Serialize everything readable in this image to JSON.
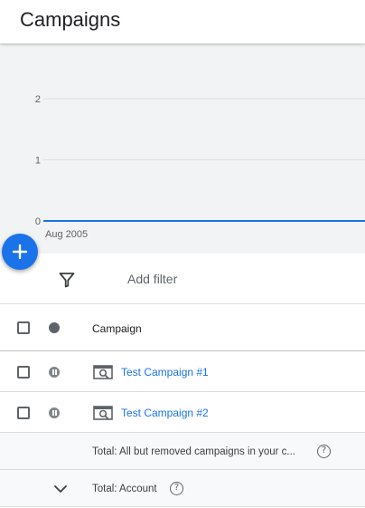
{
  "page": {
    "title": "Campaigns"
  },
  "chart_data": {
    "type": "line",
    "x": [
      "Aug 2005"
    ],
    "series": [
      {
        "values": [
          0
        ]
      }
    ],
    "y_ticks": [
      "0",
      "1",
      "2"
    ],
    "x_ticks": [
      "Aug 2005"
    ],
    "ylim": [
      0,
      2
    ],
    "grid": true,
    "colors": {
      "line": "#1a73e8",
      "grid": "#dadce0"
    }
  },
  "fab": {
    "icon": "plus-icon"
  },
  "filter": {
    "icon": "filter-icon",
    "label": "Add filter"
  },
  "table": {
    "columns": {
      "campaign": "Campaign"
    },
    "rows": [
      {
        "name": "Test Campaign #1",
        "status_icon": "pause-icon",
        "type_icon": "search-campaign-icon"
      },
      {
        "name": "Test Campaign #2",
        "status_icon": "pause-icon",
        "type_icon": "search-campaign-icon"
      }
    ],
    "totals": [
      {
        "label": "Total: All but removed campaigns in your c...",
        "help": "?"
      },
      {
        "label": "Total: Account",
        "help": "?",
        "expand_icon": "chevron-down-icon"
      }
    ]
  },
  "colors": {
    "accent": "#1a73e8",
    "chart_bg": "#f1f3f4",
    "text": "#202124",
    "muted": "#5f6368"
  }
}
